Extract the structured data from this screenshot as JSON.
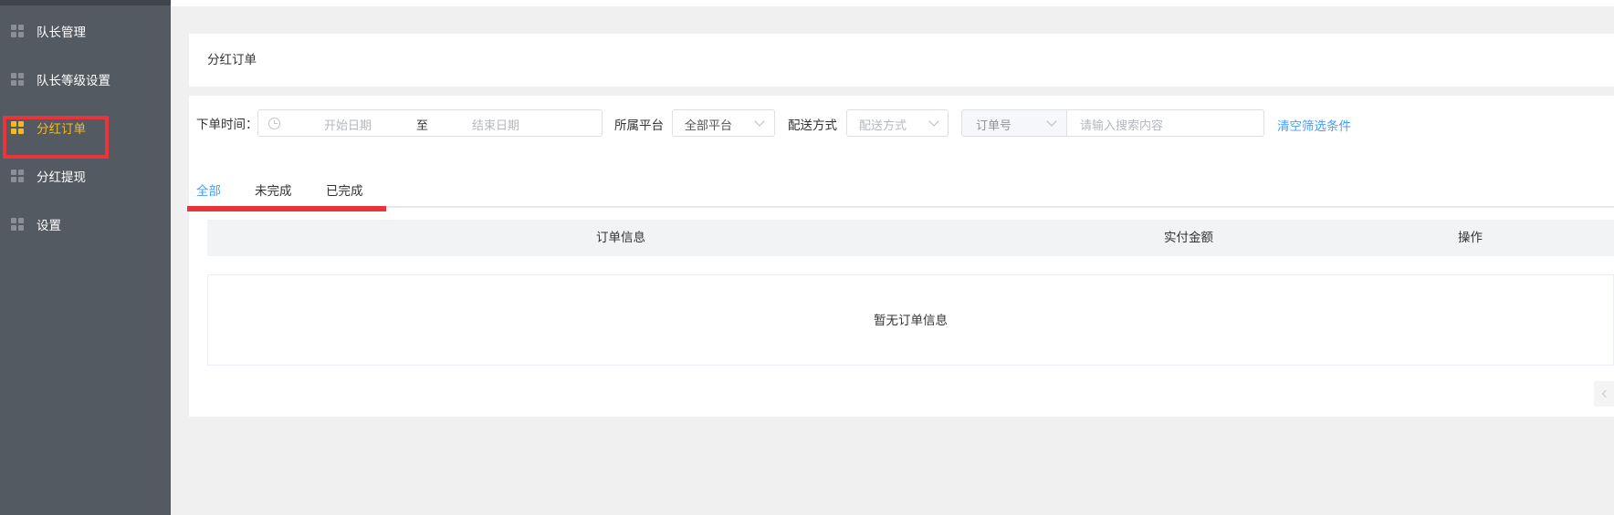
{
  "sidebar": {
    "items": [
      {
        "label": "队长管理",
        "active": false
      },
      {
        "label": "队长等级设置",
        "active": false
      },
      {
        "label": "分红订单",
        "active": true
      },
      {
        "label": "分红提现",
        "active": false
      },
      {
        "label": "设置",
        "active": false
      }
    ],
    "icon": "grid-icon",
    "active_color": "#f5b921"
  },
  "page": {
    "title": "分红订单"
  },
  "filters": {
    "order_time_label": "下单时间：",
    "start_date_placeholder": "开始日期",
    "range_separator": "至",
    "end_date_placeholder": "结束日期",
    "platform_label": "所属平台",
    "platform_value": "全部平台",
    "delivery_label": "配送方式",
    "delivery_placeholder": "配送方式",
    "search_type_value": "订单号",
    "search_placeholder": "请输入搜索内容",
    "clear_link": "清空筛选条件"
  },
  "tabs": [
    {
      "label": "全部",
      "active": true
    },
    {
      "label": "未完成",
      "active": false
    },
    {
      "label": "已完成",
      "active": false
    }
  ],
  "table": {
    "columns": [
      "订单信息",
      "实付金额",
      "操作"
    ],
    "empty_text": "暂无订单信息"
  },
  "colors": {
    "accent": "#409eff",
    "annotation_red": "#e8343a",
    "sidebar_bg": "#545a62"
  }
}
